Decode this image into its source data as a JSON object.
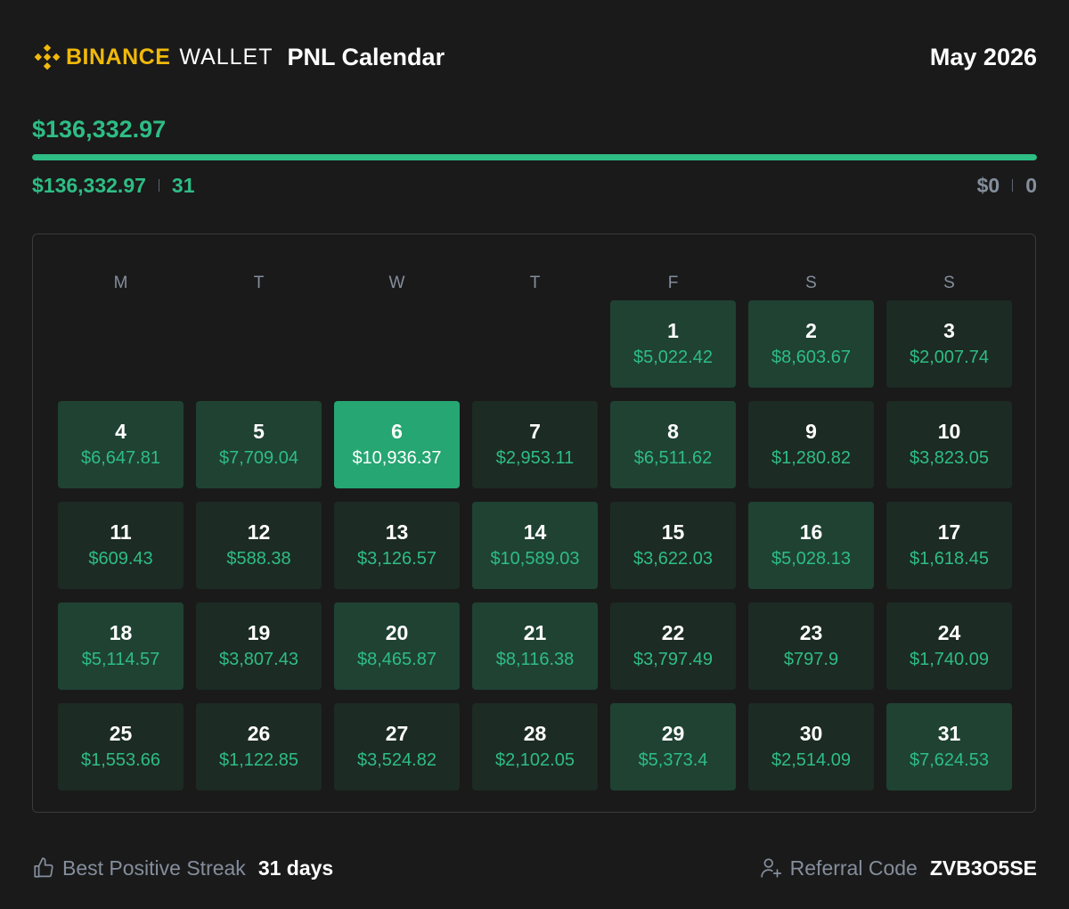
{
  "header": {
    "brand_name": "BINANCE",
    "brand_sub": "WALLET",
    "title": "PNL Calendar",
    "month": "May 2026"
  },
  "summary": {
    "total_pnl": "$136,332.97",
    "progress_fraction": 1.0,
    "positive_total": "$136,332.97",
    "positive_days": "31",
    "negative_total": "$0",
    "negative_days": "0"
  },
  "calendar": {
    "weekdays": [
      "M",
      "T",
      "W",
      "T",
      "F",
      "S",
      "S"
    ],
    "leading_blank_days": 4,
    "days": [
      {
        "day": "1",
        "pnl": "$5,022.42",
        "level": 2
      },
      {
        "day": "2",
        "pnl": "$8,603.67",
        "level": 2
      },
      {
        "day": "3",
        "pnl": "$2,007.74",
        "level": 1
      },
      {
        "day": "4",
        "pnl": "$6,647.81",
        "level": 2
      },
      {
        "day": "5",
        "pnl": "$7,709.04",
        "level": 2
      },
      {
        "day": "6",
        "pnl": "$10,936.37",
        "level": 3
      },
      {
        "day": "7",
        "pnl": "$2,953.11",
        "level": 1
      },
      {
        "day": "8",
        "pnl": "$6,511.62",
        "level": 2
      },
      {
        "day": "9",
        "pnl": "$1,280.82",
        "level": 1
      },
      {
        "day": "10",
        "pnl": "$3,823.05",
        "level": 1
      },
      {
        "day": "11",
        "pnl": "$609.43",
        "level": 1
      },
      {
        "day": "12",
        "pnl": "$588.38",
        "level": 1
      },
      {
        "day": "13",
        "pnl": "$3,126.57",
        "level": 1
      },
      {
        "day": "14",
        "pnl": "$10,589.03",
        "level": 2
      },
      {
        "day": "15",
        "pnl": "$3,622.03",
        "level": 1
      },
      {
        "day": "16",
        "pnl": "$5,028.13",
        "level": 2
      },
      {
        "day": "17",
        "pnl": "$1,618.45",
        "level": 1
      },
      {
        "day": "18",
        "pnl": "$5,114.57",
        "level": 2
      },
      {
        "day": "19",
        "pnl": "$3,807.43",
        "level": 1
      },
      {
        "day": "20",
        "pnl": "$8,465.87",
        "level": 2
      },
      {
        "day": "21",
        "pnl": "$8,116.38",
        "level": 2
      },
      {
        "day": "22",
        "pnl": "$3,797.49",
        "level": 1
      },
      {
        "day": "23",
        "pnl": "$797.9",
        "level": 1
      },
      {
        "day": "24",
        "pnl": "$1,740.09",
        "level": 1
      },
      {
        "day": "25",
        "pnl": "$1,553.66",
        "level": 1
      },
      {
        "day": "26",
        "pnl": "$1,122.85",
        "level": 1
      },
      {
        "day": "27",
        "pnl": "$3,524.82",
        "level": 1
      },
      {
        "day": "28",
        "pnl": "$2,102.05",
        "level": 1
      },
      {
        "day": "29",
        "pnl": "$5,373.4",
        "level": 2
      },
      {
        "day": "30",
        "pnl": "$2,514.09",
        "level": 1
      },
      {
        "day": "31",
        "pnl": "$7,624.53",
        "level": 2
      }
    ]
  },
  "footer": {
    "streak_icon": "thumbs-up-icon",
    "streak_label": "Best Positive Streak",
    "streak_value": "31 days",
    "referral_icon": "add-user-icon",
    "referral_label": "Referral Code",
    "referral_code": "ZVB3O5SE"
  },
  "colors": {
    "background": "#1a1a1a",
    "brand_yellow": "#f0b90b",
    "profit_green": "#2ebd85",
    "muted_grey": "#848e9c",
    "cell_low": "#1c2b24",
    "cell_mid": "#1f4233",
    "cell_high": "#26a672"
  }
}
